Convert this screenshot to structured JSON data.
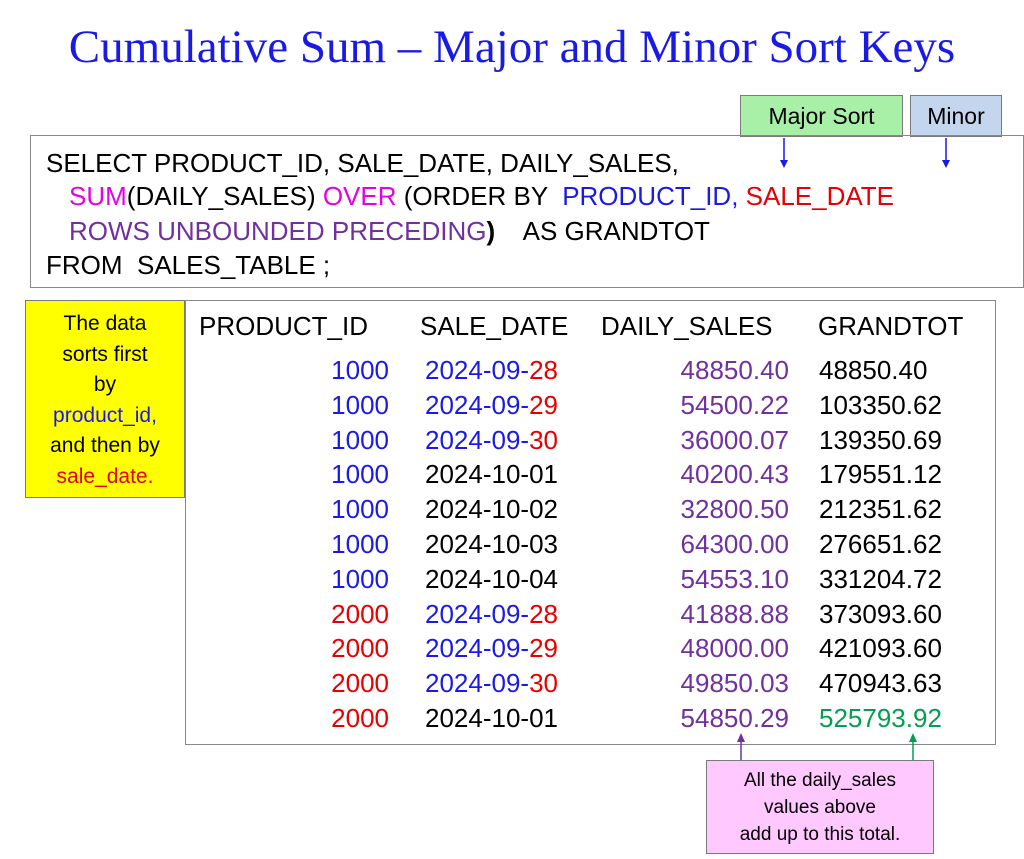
{
  "title": "Cumulative Sum – Major and Minor Sort Keys",
  "callouts": {
    "major": "Major Sort",
    "minor": "Minor"
  },
  "sql": {
    "line1": "SELECT PRODUCT_ID, SALE_DATE, DAILY_SALES,",
    "line2": {
      "sum": "SUM",
      "args": "(DAILY_SALES) ",
      "over": "OVER",
      "order": " (ORDER BY  ",
      "major": "PRODUCT_ID,",
      "minor": " SALE_DATE"
    },
    "line3": {
      "rows": "ROWS UNBOUNDED PRECEDING",
      "paren": ")",
      "alias": "    AS GRANDTOT"
    },
    "line4": "FROM  SALES_TABLE ;"
  },
  "note_left": {
    "l1": "The data",
    "l2": "sorts first",
    "l3": "by",
    "l4": "product_id,",
    "l5": "and then by",
    "l6": "sale_date."
  },
  "table": {
    "headers": [
      "PRODUCT_ID",
      "SALE_DATE",
      "DAILY_SALES",
      "GRANDTOT"
    ],
    "rows": [
      {
        "pid": "1000",
        "date_a": "2024-09-",
        "date_b": "28",
        "sales": "48850.40",
        "grand": "48850.40"
      },
      {
        "pid": "1000",
        "date_a": "2024-09-",
        "date_b": "29",
        "sales": "54500.22",
        "grand": "103350.62"
      },
      {
        "pid": "1000",
        "date_a": "2024-09-",
        "date_b": "30",
        "sales": "36000.07",
        "grand": "139350.69"
      },
      {
        "pid": "1000",
        "date_a": "2024-10-01",
        "date_b": "",
        "sales": "40200.43",
        "grand": "179551.12"
      },
      {
        "pid": "1000",
        "date_a": "2024-10-02",
        "date_b": "",
        "sales": "32800.50",
        "grand": "212351.62"
      },
      {
        "pid": "1000",
        "date_a": "2024-10-03",
        "date_b": "",
        "sales": "64300.00",
        "grand": "276651.62"
      },
      {
        "pid": "1000",
        "date_a": "2024-10-04",
        "date_b": "",
        "sales": "54553.10",
        "grand": "331204.72"
      },
      {
        "pid": "2000",
        "date_a": "2024-09-",
        "date_b": "28",
        "sales": "41888.88",
        "grand": "373093.60"
      },
      {
        "pid": "2000",
        "date_a": "2024-09-",
        "date_b": "29",
        "sales": "48000.00",
        "grand": "421093.60"
      },
      {
        "pid": "2000",
        "date_a": "2024-09-",
        "date_b": "30",
        "sales": "49850.03",
        "grand": "470943.63"
      },
      {
        "pid": "2000",
        "date_a": "2024-10-01",
        "date_b": "",
        "sales": "54850.29",
        "grand": "525793.92"
      }
    ]
  },
  "note_bottom": {
    "l1": "All the daily_sales",
    "l2": "values above",
    "l3": "add up to this total."
  },
  "colors": {
    "title": "#1a1ae6",
    "major_key": "#1a1ae6",
    "minor_key": "#e60000",
    "window_fn": "#e600e6",
    "frame": "#7030a0",
    "total": "#00a050",
    "major_callout_bg": "#a8f0a8",
    "minor_callout_bg": "#c4d6ee",
    "left_note_bg": "#ffff00",
    "bottom_note_bg": "#ffc8ff"
  }
}
